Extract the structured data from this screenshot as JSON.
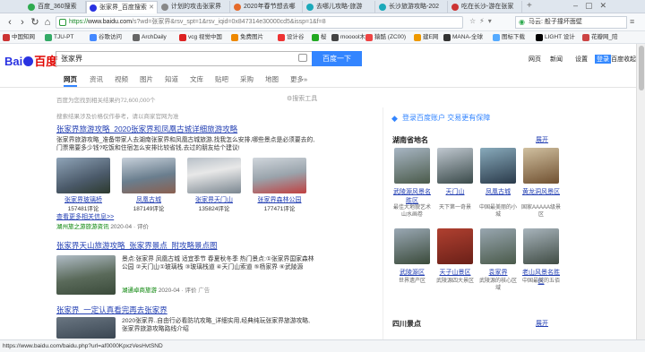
{
  "tabs": [
    {
      "label": "百度_360搜索",
      "color": "#2eaa4f",
      "active": false
    },
    {
      "label": "张家界_百度搜索",
      "color": "#2932e1",
      "active": true
    },
    {
      "label": "计划的攻击张家界",
      "color": "#888",
      "active": false
    },
    {
      "label": "2020年春节想去哪",
      "color": "#e56b2b",
      "active": false
    },
    {
      "label": "去哪儿攻略-旅游",
      "color": "#1ba9ba",
      "active": false
    },
    {
      "label": "长沙旅游攻略-202",
      "color": "#1ba9ba",
      "active": false
    },
    {
      "label": "吃在长沙-游在张家",
      "color": "#c33",
      "active": false
    }
  ],
  "nav": {
    "back": "‹",
    "forward": "›",
    "reload": "↻",
    "home": "⌂",
    "url_https": "https://",
    "url_host": "www.baidu.com",
    "url_path": "/s?wd=张家界&rsv_spt=1&rsv_iqid=0x847314e30000cd5&issp=1&f=8",
    "search_box": "马云: 般子撞坏面壁"
  },
  "bookmarks": [
    "中国知网",
    "TJU-PT",
    "谷歌访问",
    "ArchDaily",
    "vcg 视觉中国",
    "免费图片",
    "设计谷",
    "桜",
    "mooool木",
    "猿酷 (ZC00)",
    "建E网",
    "MANA-全球",
    "图标下载",
    "LIGHT 设计",
    "花瓣网_陪"
  ],
  "baidu": {
    "logo_bai": "Bai",
    "logo_du": "du",
    "logo_cn": "百度",
    "query": "张家界",
    "search_btn": "百度一下",
    "top_links": [
      "网页",
      "新闻",
      "设置",
      "登录",
      "百度收起"
    ],
    "tabs": [
      "网页",
      "资讯",
      "视频",
      "图片",
      "知道",
      "文库",
      "贴吧",
      "采购",
      "地图",
      "更多»"
    ],
    "result_count": "百度为您找到相关结果约72,600,000个",
    "tools": "搜索工具",
    "notice": "搜索结果涉及价格仅作参考，请以商家官网为准"
  },
  "results": [
    {
      "title": "张家界旅游攻略_2020张家界和凤凰古城详细旅游攻略",
      "snippet": "张家界旅游攻略_准备带家人去湖南张家界和凤凰古城旅游,找我怎么安排,哪些景点是必须要去的,门票需要多少钱?吃饭和住宿怎么安排比较省钱,去过的朋友给个建议!",
      "images": [
        {
          "name": "张家界玻璃桥",
          "count": "157481评论"
        },
        {
          "name": "凤凰古城",
          "count": "187149评论"
        },
        {
          "name": "张家界天门山",
          "count": "135824评论"
        },
        {
          "name": "张家界森林公园",
          "count": "177471评论"
        }
      ],
      "more": "查看更多相关信息>>",
      "source": "湖州旅之游旅游资讯",
      "date": "2020-04",
      "rating": "评价"
    },
    {
      "title": "张家界天山旅游攻略_张家界景点_附攻略景点图",
      "snippet": "景点:张家界 凤凰古城 适宜季节 春夏秋冬季 热门景点:①张家界国家森林公园 ②天门山①玻璃栈 ③玻璃栈道 ④天门山索道 ⑤杨家界 ⑥武陵源",
      "source": "湖通卓商旅游",
      "date": "2020-04",
      "rating": "评价",
      "ad": "广告"
    },
    {
      "title": "张家界_一定认真看完再去张家界",
      "snippet": "2020张家界..自由行必看防坑攻略_详细实用,经典纯玩张家界旅游攻略,张家界旅游攻略路线介绍",
      "source": "",
      "date": "",
      "rating": ""
    }
  ],
  "right": {
    "login": "登录百度账户 交易更有保障",
    "section1": "湖南省地名",
    "expand": "展开",
    "places1": [
      {
        "name": "武陵源风景名胜区",
        "desc": "最佳大地貌艺术山水画卷"
      },
      {
        "name": "天门山",
        "desc": "天下第一奇景"
      },
      {
        "name": "凤凰古城",
        "desc": "中国最美丽的小城"
      },
      {
        "name": "黄龙洞风景区",
        "desc": "国家AAAAA级景区"
      }
    ],
    "places2": [
      {
        "name": "武陵源区",
        "desc": "世界遗产区"
      },
      {
        "name": "天子山景区",
        "desc": "武陵源四大景区"
      },
      {
        "name": "袁家界",
        "desc": "武陵源的核心区域"
      },
      {
        "name": "老山风景名胜区",
        "desc": "中国最美的五佰"
      }
    ],
    "section2": "四川景点"
  },
  "status_url": "https://www.baidu.com/baidu.php?url=af0000KpxzVesHvtSND"
}
